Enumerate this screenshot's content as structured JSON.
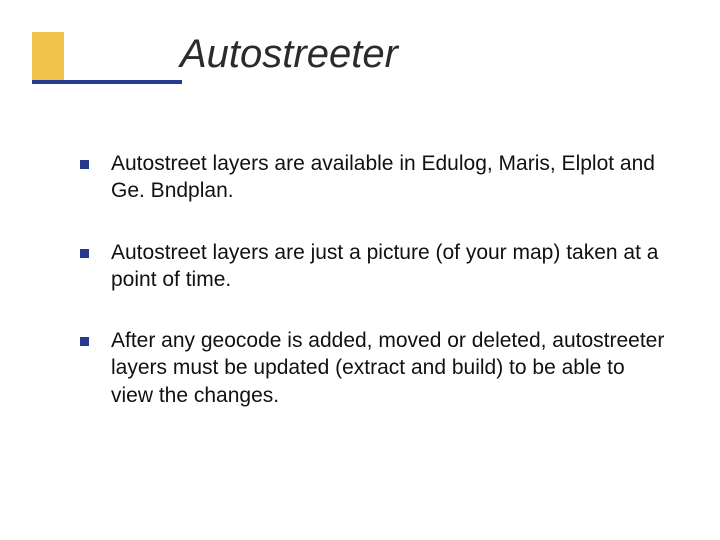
{
  "slide": {
    "title": "Autostreeter",
    "bullets": [
      "Autostreet layers are available in Edulog, Maris, Elplot and Ge. Bndplan.",
      "Autostreet layers are just a picture (of your map) taken at a point of time.",
      "After any geocode is added, moved or deleted, autostreeter layers must be updated (extract and build) to be able to view the changes."
    ]
  }
}
